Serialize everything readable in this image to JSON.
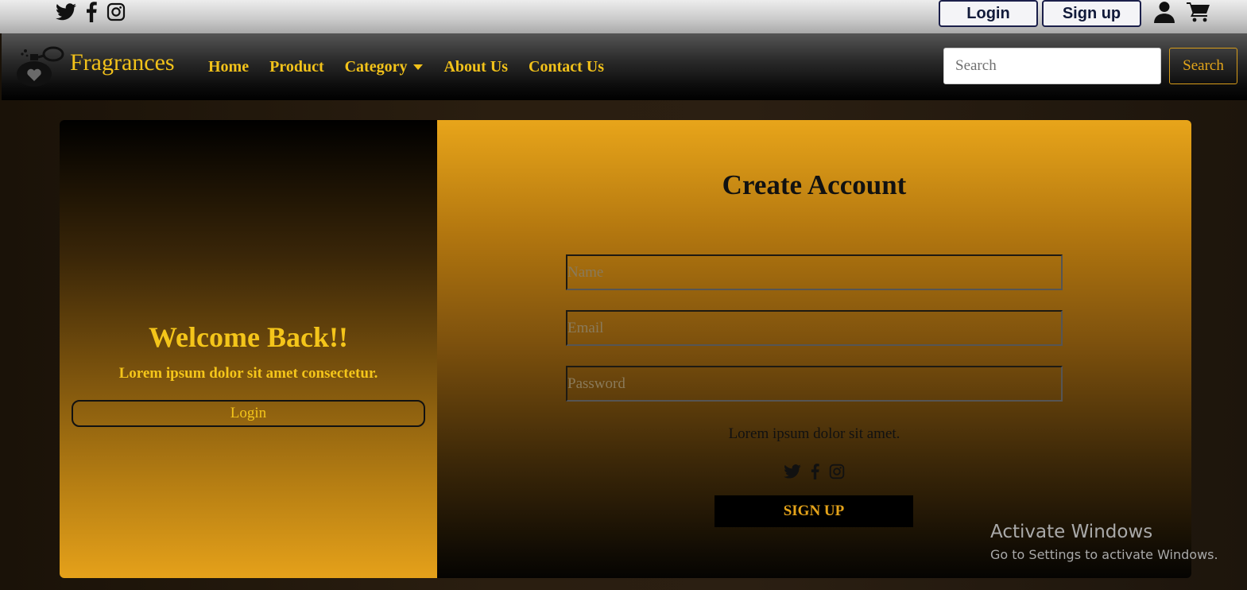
{
  "topbar": {
    "social_icons": [
      "twitter-icon",
      "facebook-icon",
      "instagram-icon"
    ],
    "login_label": "Login",
    "signup_label": "Sign up",
    "icons": [
      "user-icon",
      "cart-icon"
    ]
  },
  "navbar": {
    "brand": "Fragrances",
    "links": [
      {
        "label": "Home"
      },
      {
        "label": "Product"
      },
      {
        "label": "Category"
      },
      {
        "label": "About Us"
      },
      {
        "label": "Contact Us"
      }
    ],
    "search_placeholder": "Search",
    "search_button": "Search"
  },
  "left_panel": {
    "title": "Welcome Back!!",
    "subtitle": "Lorem ipsum dolor sit amet consectetur.",
    "login_button": "Login"
  },
  "right_panel": {
    "title": "Create Account",
    "name_placeholder": "Name",
    "email_placeholder": "Email",
    "password_placeholder": "Password",
    "text": "Lorem ipsum dolor sit amet.",
    "signup_button": "SIGN UP"
  },
  "watermark": {
    "title": "Activate Windows",
    "subtitle": "Go to Settings to activate Windows."
  },
  "colors": {
    "accent": "#f2c21a",
    "gold": "#e5a11a",
    "navy": "#1b1f4a"
  }
}
